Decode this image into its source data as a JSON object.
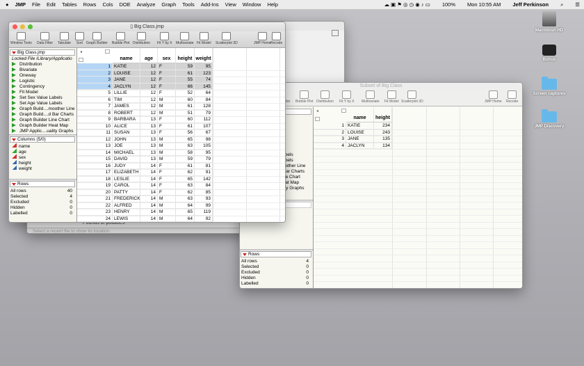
{
  "menubar": {
    "apple": "",
    "items": [
      "JMP",
      "File",
      "Edit",
      "Tables",
      "Rows",
      "Cols",
      "DOE",
      "Analyze",
      "Graph",
      "Tools",
      "Add-Ins",
      "View",
      "Window",
      "Help"
    ],
    "battery": "100%",
    "clock": "Mon 10:55 AM",
    "user": "Jeff Perkinson"
  },
  "desktop": {
    "icons": [
      "Macintosh HD",
      "Bonus",
      "Screen captures",
      "JMP Discovery"
    ]
  },
  "home_window": {
    "recent_item": "Pounds of potatoes",
    "status": "Select a recent file to show its location."
  },
  "big_class": {
    "title": "Big Class.jmp",
    "toolbar": [
      "Window Tools",
      "Data Filter",
      "Tabulate",
      "Sort",
      "Graph Builder",
      "Bubble Plot",
      "Distribution",
      "Fit Y by X",
      "Multivariate",
      "Fit Model",
      "Scatterplot 3D",
      "JMP Home",
      "Recode"
    ],
    "table_name": "Big Class.jmp",
    "locked": "Locked File  /Library/Applicatio",
    "scripts": [
      "Distribution",
      "Bivariate",
      "Oneway",
      "Logistic",
      "Contingency",
      "Fit Model",
      "Set Sex Value Labels",
      "Set Age Value Labels",
      "Graph Build....moother Line",
      "Graph Build....d Bar Charts",
      "Graph Builder Line Chart",
      "Graph Builder Heat Map",
      "JMP Applic....uality Graphs"
    ],
    "columns_header": "Columns (5/0)",
    "columns": [
      "name",
      "age",
      "sex",
      "height",
      "weight"
    ],
    "rows_header": "Rows",
    "rows_stats": [
      [
        "All rows",
        "40"
      ],
      [
        "Selected",
        "4"
      ],
      [
        "Excluded",
        "0"
      ],
      [
        "Hidden",
        "0"
      ],
      [
        "Labelled",
        "0"
      ]
    ],
    "headers": [
      "name",
      "age",
      "sex",
      "height",
      "weight"
    ],
    "selected_rows": [
      1,
      2,
      3,
      4
    ],
    "rows": [
      [
        "KATIE",
        "12",
        "F",
        "59",
        "95"
      ],
      [
        "LOUISE",
        "12",
        "F",
        "61",
        "123"
      ],
      [
        "JANE",
        "12",
        "F",
        "55",
        "74"
      ],
      [
        "JACLYN",
        "12",
        "F",
        "66",
        "145"
      ],
      [
        "LILLIE",
        "12",
        "F",
        "52",
        "64"
      ],
      [
        "TIM",
        "12",
        "M",
        "60",
        "84"
      ],
      [
        "JAMES",
        "12",
        "M",
        "61",
        "128"
      ],
      [
        "ROBERT",
        "12",
        "M",
        "51",
        "79"
      ],
      [
        "BARBARA",
        "13",
        "F",
        "60",
        "112"
      ],
      [
        "ALICE",
        "13",
        "F",
        "61",
        "107"
      ],
      [
        "SUSAN",
        "13",
        "F",
        "56",
        "67"
      ],
      [
        "JOHN",
        "13",
        "M",
        "65",
        "98"
      ],
      [
        "JOE",
        "13",
        "M",
        "63",
        "105"
      ],
      [
        "MICHAEL",
        "13",
        "M",
        "58",
        "95"
      ],
      [
        "DAVID",
        "13",
        "M",
        "59",
        "79"
      ],
      [
        "JUDY",
        "14",
        "F",
        "61",
        "81"
      ],
      [
        "ELIZABETH",
        "14",
        "F",
        "62",
        "91"
      ],
      [
        "LESLIE",
        "14",
        "F",
        "65",
        "142"
      ],
      [
        "CAROL",
        "14",
        "F",
        "63",
        "84"
      ],
      [
        "PATTY",
        "14",
        "F",
        "62",
        "85"
      ],
      [
        "FREDERICK",
        "14",
        "M",
        "63",
        "93"
      ],
      [
        "ALFRED",
        "14",
        "M",
        "64",
        "99"
      ],
      [
        "HENRY",
        "14",
        "M",
        "65",
        "119"
      ],
      [
        "LEWIS",
        "14",
        "M",
        "64",
        "92"
      ]
    ]
  },
  "subset": {
    "title": "Subset of Big Class",
    "toolbar": [
      "Tabulate",
      "Sort",
      "Graph Builder",
      "Bubble Plot",
      "Distribution",
      "Fit Y by X",
      "Multivariate",
      "Fit Model",
      "Scatterplot 3D",
      "JMP Home",
      "Recode"
    ],
    "scripts": [
      "Set Sex Value Labels",
      "Set Age Value Labels",
      "Graph Build....moother Line",
      "Graph Build....d Bar Charts",
      "Graph Builder Line Chart",
      "Graph Builder Heat Map",
      "JMP Applic....uality Graphs"
    ],
    "rows_header": "Rows",
    "rows_stats": [
      [
        "All rows",
        "4"
      ],
      [
        "Selected",
        "0"
      ],
      [
        "Excluded",
        "0"
      ],
      [
        "Hidden",
        "0"
      ],
      [
        "Labelled",
        "0"
      ]
    ],
    "headers": [
      "name",
      "height"
    ],
    "rows": [
      [
        "KATIE",
        "234"
      ],
      [
        "LOUISE",
        "243"
      ],
      [
        "JANE",
        "135"
      ],
      [
        "JACLYN",
        "134"
      ]
    ]
  }
}
